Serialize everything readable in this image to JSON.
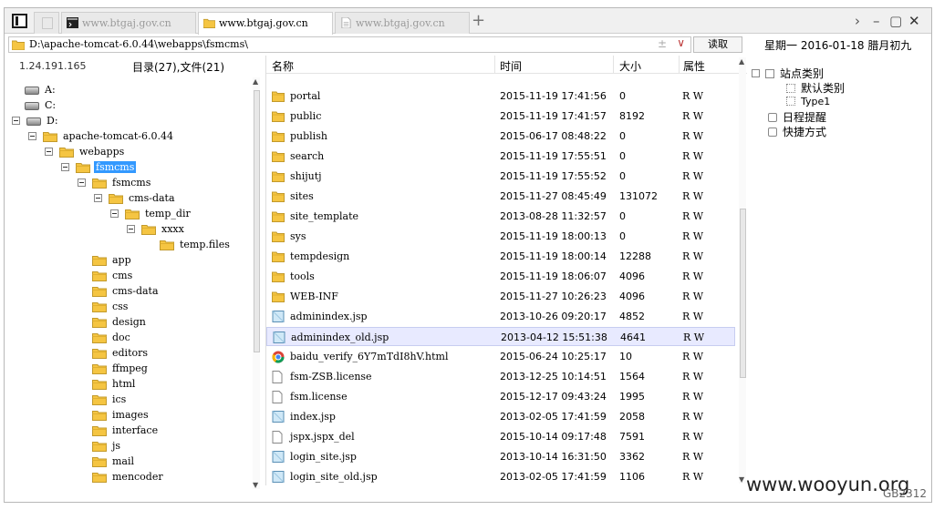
{
  "tabs": [
    {
      "label": "www.btgaj.gov.cn",
      "icon": "terminal-icon",
      "active": false
    },
    {
      "label": "www.btgaj.gov.cn",
      "icon": "folder-icon",
      "active": true
    },
    {
      "label": "www.btgaj.gov.cn",
      "icon": "document-icon",
      "active": false
    }
  ],
  "address": {
    "path": "D:\\apache-tomcat-6.0.44\\webapps\\fsmcms\\",
    "pm": "±",
    "dropdown": "∨"
  },
  "read_button": "读取",
  "date": "星期一  2016-01-18  腊月初九",
  "ip": "1.24.191.165",
  "dir_summary": "目录(27),文件(21)",
  "tree": [
    {
      "label": "A:",
      "type": "drive"
    },
    {
      "label": "C:",
      "type": "drive"
    },
    {
      "label": "D:",
      "type": "drive"
    },
    {
      "label": "apache-tomcat-6.0.44",
      "type": "folder"
    },
    {
      "label": "webapps",
      "type": "folder"
    },
    {
      "label": "fsmcms",
      "type": "folder"
    },
    {
      "label": "fsmcms",
      "type": "folder"
    },
    {
      "label": "cms-data",
      "type": "folder"
    },
    {
      "label": "temp_dir",
      "type": "folder"
    },
    {
      "label": "xxxx",
      "type": "folder"
    },
    {
      "label": "temp.files",
      "type": "folder"
    },
    {
      "label": "app",
      "type": "folder"
    },
    {
      "label": "cms",
      "type": "folder"
    },
    {
      "label": "cms-data",
      "type": "folder"
    },
    {
      "label": "css",
      "type": "folder"
    },
    {
      "label": "design",
      "type": "folder"
    },
    {
      "label": "doc",
      "type": "folder"
    },
    {
      "label": "editors",
      "type": "folder"
    },
    {
      "label": "ffmpeg",
      "type": "folder"
    },
    {
      "label": "html",
      "type": "folder"
    },
    {
      "label": "ics",
      "type": "folder"
    },
    {
      "label": "images",
      "type": "folder"
    },
    {
      "label": "interface",
      "type": "folder"
    },
    {
      "label": "js",
      "type": "folder"
    },
    {
      "label": "mail",
      "type": "folder"
    },
    {
      "label": "mencoder",
      "type": "folder"
    }
  ],
  "columns": {
    "name": "名称",
    "time": "时间",
    "size": "大小",
    "attr": "属性"
  },
  "files": [
    {
      "name": "portal",
      "time": "2015-11-19 17:41:56",
      "size": "0",
      "attr": "R W",
      "icon": "folder"
    },
    {
      "name": "public",
      "time": "2015-11-19 17:41:57",
      "size": "8192",
      "attr": "R W",
      "icon": "folder"
    },
    {
      "name": "publish",
      "time": "2015-06-17 08:48:22",
      "size": "0",
      "attr": "R W",
      "icon": "folder"
    },
    {
      "name": "search",
      "time": "2015-11-19 17:55:51",
      "size": "0",
      "attr": "R W",
      "icon": "folder"
    },
    {
      "name": "shijutj",
      "time": "2015-11-19 17:55:52",
      "size": "0",
      "attr": "R W",
      "icon": "folder"
    },
    {
      "name": "sites",
      "time": "2015-11-27 08:45:49",
      "size": "131072",
      "attr": "R W",
      "icon": "folder"
    },
    {
      "name": "site_template",
      "time": "2013-08-28 11:32:57",
      "size": "0",
      "attr": "R W",
      "icon": "folder"
    },
    {
      "name": "sys",
      "time": "2015-11-19 18:00:13",
      "size": "0",
      "attr": "R W",
      "icon": "folder"
    },
    {
      "name": "tempdesign",
      "time": "2015-11-19 18:00:14",
      "size": "12288",
      "attr": "R W",
      "icon": "folder"
    },
    {
      "name": "tools",
      "time": "2015-11-19 18:06:07",
      "size": "4096",
      "attr": "R W",
      "icon": "folder"
    },
    {
      "name": "WEB-INF",
      "time": "2015-11-27 10:26:23",
      "size": "4096",
      "attr": "R W",
      "icon": "folder"
    },
    {
      "name": "adminindex.jsp",
      "time": "2013-10-26 09:20:17",
      "size": "4852",
      "attr": "R W",
      "icon": "jsp"
    },
    {
      "name": "adminindex_old.jsp",
      "time": "2013-04-12 15:51:38",
      "size": "4641",
      "attr": "R W",
      "icon": "jsp"
    },
    {
      "name": "baidu_verify_6Y7mTdI8hV.html",
      "time": "2015-06-24 10:25:17",
      "size": "10",
      "attr": "R W",
      "icon": "chrome"
    },
    {
      "name": "fsm-ZSB.license",
      "time": "2013-12-25 10:14:51",
      "size": "1564",
      "attr": "R W",
      "icon": "blank"
    },
    {
      "name": "fsm.license",
      "time": "2015-12-17 09:43:24",
      "size": "1995",
      "attr": "R W",
      "icon": "blank"
    },
    {
      "name": "index.jsp",
      "time": "2013-02-05 17:41:59",
      "size": "2058",
      "attr": "R W",
      "icon": "jsp"
    },
    {
      "name": "jspx.jspx_del",
      "time": "2015-10-14 09:17:48",
      "size": "7591",
      "attr": "R W",
      "icon": "blank"
    },
    {
      "name": "login_site.jsp",
      "time": "2013-10-14 16:31:50",
      "size": "3362",
      "attr": "R W",
      "icon": "jsp"
    },
    {
      "name": "login_site_old.jsp",
      "time": "2013-02-05 17:41:59",
      "size": "1106",
      "attr": "R W",
      "icon": "jsp"
    }
  ],
  "selected_file_index": 12,
  "right_panel": {
    "site_types": "站点类别",
    "default_type": "默认类别",
    "type1": "Type1",
    "reminder": "日程提醒",
    "shortcut": "快捷方式"
  },
  "watermark": "www.wooyun.org",
  "encoding": "GB2312",
  "colors": {
    "selection": "#3399ff",
    "row_highlight": "#e8eaff",
    "folder": "#f5c542"
  }
}
